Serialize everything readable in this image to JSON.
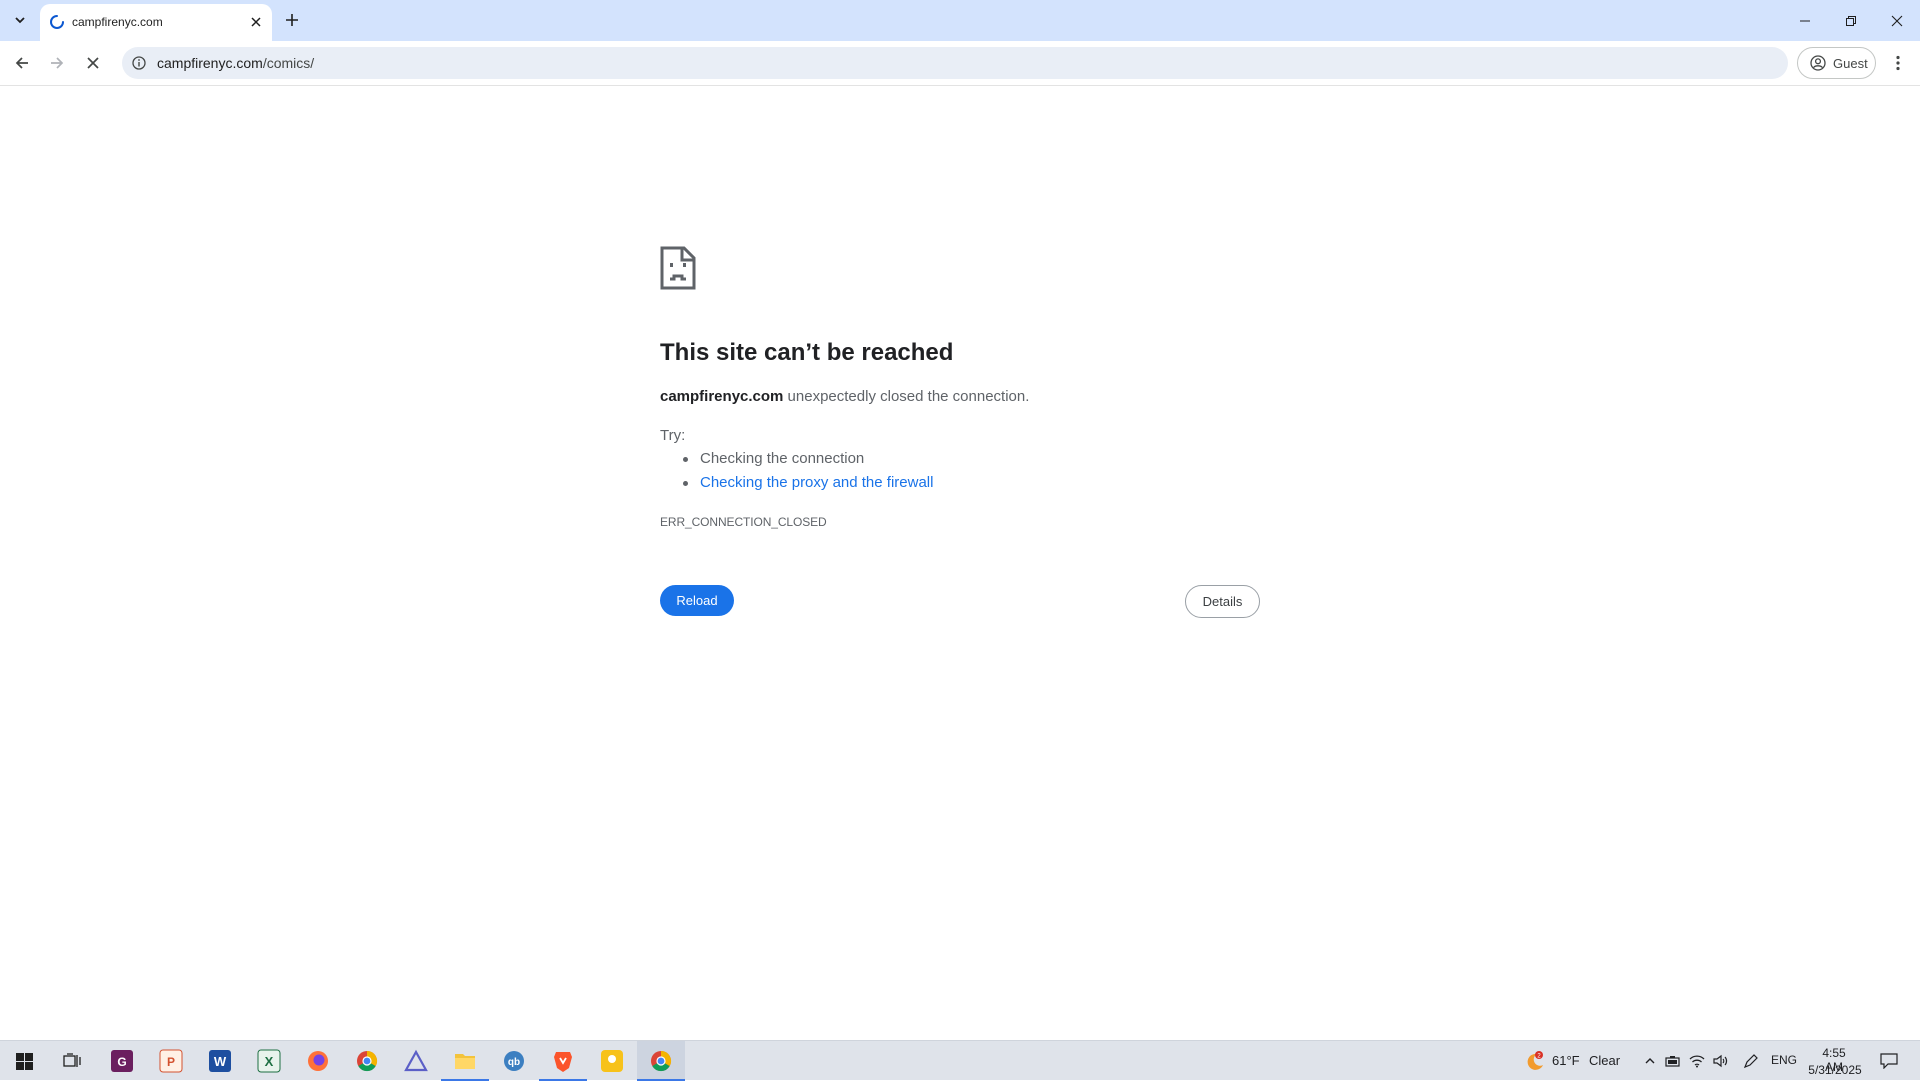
{
  "browser": {
    "tab": {
      "title": "campfirenyc.com"
    },
    "address_bar": {
      "domain": "campfirenyc.com",
      "path": "/comics/"
    },
    "profile": {
      "label": "Guest"
    }
  },
  "error_page": {
    "heading": "This site can’t be reached",
    "summary_host": "campfirenyc.com",
    "summary_text": " unexpectedly closed the connection.",
    "try_label": "Try:",
    "suggestions": [
      {
        "text": "Checking the connection"
      },
      {
        "text": "Checking the proxy and the firewall"
      }
    ],
    "error_code": "ERR_CONNECTION_CLOSED",
    "reload_label": "Reload",
    "details_label": "Details"
  },
  "taskbar": {
    "weather": {
      "temp": "61°F",
      "condition": "Clear",
      "badge": "2"
    },
    "language": "ENG",
    "time": "4:55 AM",
    "date": "5/31/2025"
  },
  "colors": {
    "tab_strip": "#d3e3fd",
    "link": "#1a73e8",
    "primary_button": "#1a73e8",
    "taskbar": "#dfe3ea"
  }
}
